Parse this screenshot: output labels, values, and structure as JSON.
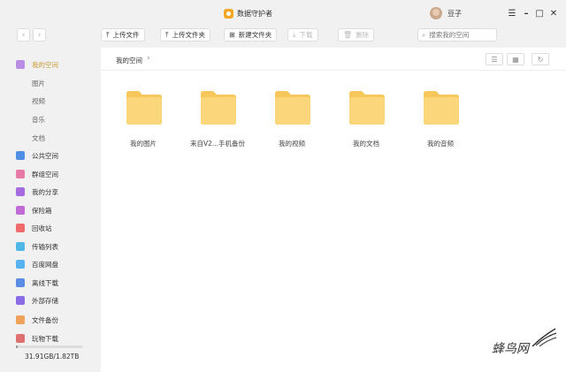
{
  "app": {
    "title": "数据守护者",
    "username": "豆子"
  },
  "window_controls": {
    "menu": "☰",
    "minimize": "–",
    "maximize": "□",
    "close": "✕"
  },
  "toolbar": {
    "back": "‹",
    "forward": "›",
    "upload_file": "上传文件",
    "upload_folder": "上传文件夹",
    "new_folder": "新建文件夹",
    "download": "下载",
    "delete": "删除",
    "search_placeholder": "搜索我的空间"
  },
  "sidebar": {
    "items": [
      {
        "label": "我的空间",
        "icon": "my-space-icon",
        "color": "#b98de6",
        "active": true
      },
      {
        "label": "图片",
        "sub": true
      },
      {
        "label": "视频",
        "sub": true
      },
      {
        "label": "音乐",
        "sub": true
      },
      {
        "label": "文档",
        "sub": true
      },
      {
        "label": "公共空间",
        "icon": "public-space-icon",
        "color": "#4f8fe6"
      },
      {
        "label": "群组空间",
        "icon": "group-space-icon",
        "color": "#e87aa8"
      },
      {
        "label": "我的分享",
        "icon": "share-icon",
        "color": "#a66be0"
      },
      {
        "label": "保险箱",
        "icon": "safe-icon",
        "color": "#c06bd6"
      },
      {
        "label": "回收站",
        "icon": "recycle-bin-icon",
        "color": "#f06b6b"
      },
      {
        "label": "传输列表",
        "icon": "transfer-list-icon",
        "color": "#4fb8e6"
      },
      {
        "label": "百度网盘",
        "icon": "baidu-netdisk-icon",
        "color": "#56b3f0"
      },
      {
        "label": "离线下载",
        "icon": "offline-download-icon",
        "color": "#5c8de6"
      },
      {
        "label": "外部存储",
        "icon": "external-storage-icon",
        "color": "#8b6be6"
      },
      {
        "label": "文件备份",
        "icon": "file-backup-icon",
        "color": "#f0a25a"
      },
      {
        "label": "玩物下载",
        "icon": "wanwu-download-icon",
        "color": "#e07070"
      }
    ],
    "storage_text": "31.91GB/1.82TB",
    "storage_used_fraction": 0.017
  },
  "main": {
    "breadcrumb": "我的空间",
    "breadcrumb_sep": "›",
    "view_list": "☰",
    "view_grid": "▦",
    "refresh": "↻",
    "folders": [
      {
        "label": "我的图片"
      },
      {
        "label": "来自V2...手机备份"
      },
      {
        "label": "我的视频"
      },
      {
        "label": "我的文档"
      },
      {
        "label": "我的音频"
      }
    ]
  },
  "watermark": "蜂鸟网",
  "colors": {
    "accent": "#c89a38",
    "folder": "#fbd67a",
    "folder_tab": "#f6c75a"
  }
}
